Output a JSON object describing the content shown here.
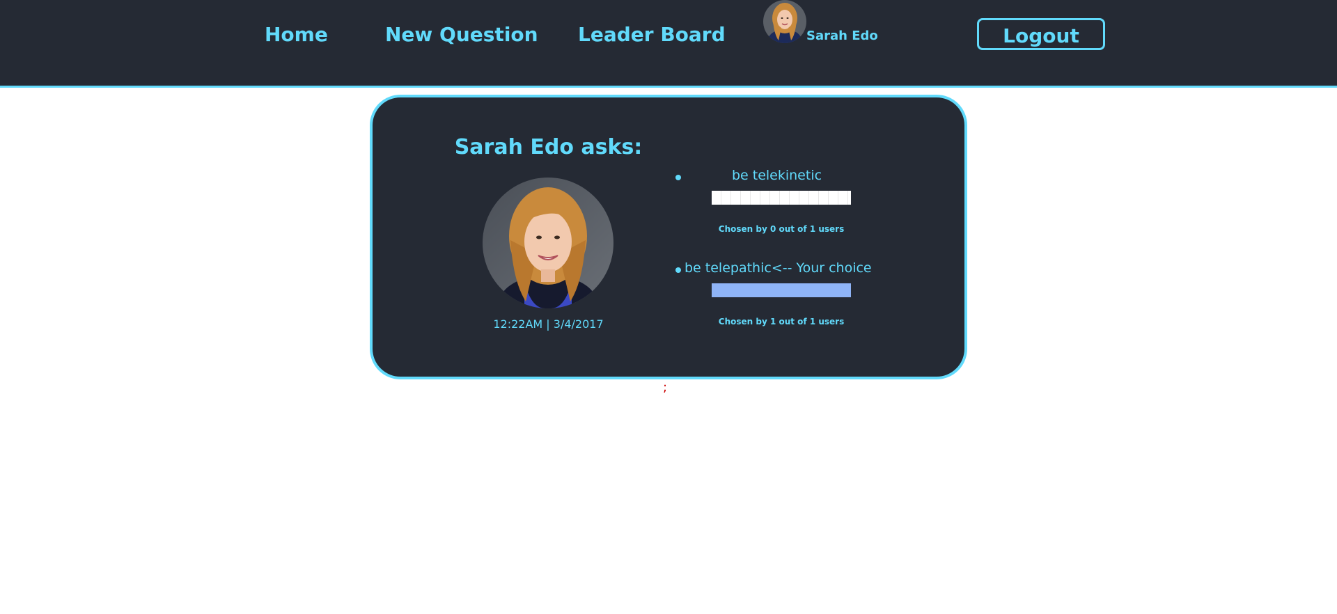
{
  "nav": {
    "home": "Home",
    "new_question": "New Question",
    "leader_board": "Leader Board",
    "user_name": "Sarah Edo",
    "logout": "Logout"
  },
  "question": {
    "asker_title": "Sarah Edo asks:",
    "timestamp": "12:22AM | 3/4/2017",
    "options": [
      {
        "text": "be telekinetic",
        "your_choice": false,
        "chosen_text": "Chosen by 0 out of 1 users",
        "percent": 0
      },
      {
        "text": "be telepathic<-- Your choice",
        "your_choice": true,
        "chosen_text": "Chosen by 1 out of 1 users",
        "percent": 100
      }
    ]
  },
  "stray_text": ";",
  "colors": {
    "accent": "#61dafb",
    "dark_bg": "#252a34",
    "progress_fill": "#8fb4f7",
    "stray": "#cc0000"
  },
  "icons": {
    "nav_avatar": "user-avatar-photo",
    "big_avatar": "user-avatar-photo"
  }
}
